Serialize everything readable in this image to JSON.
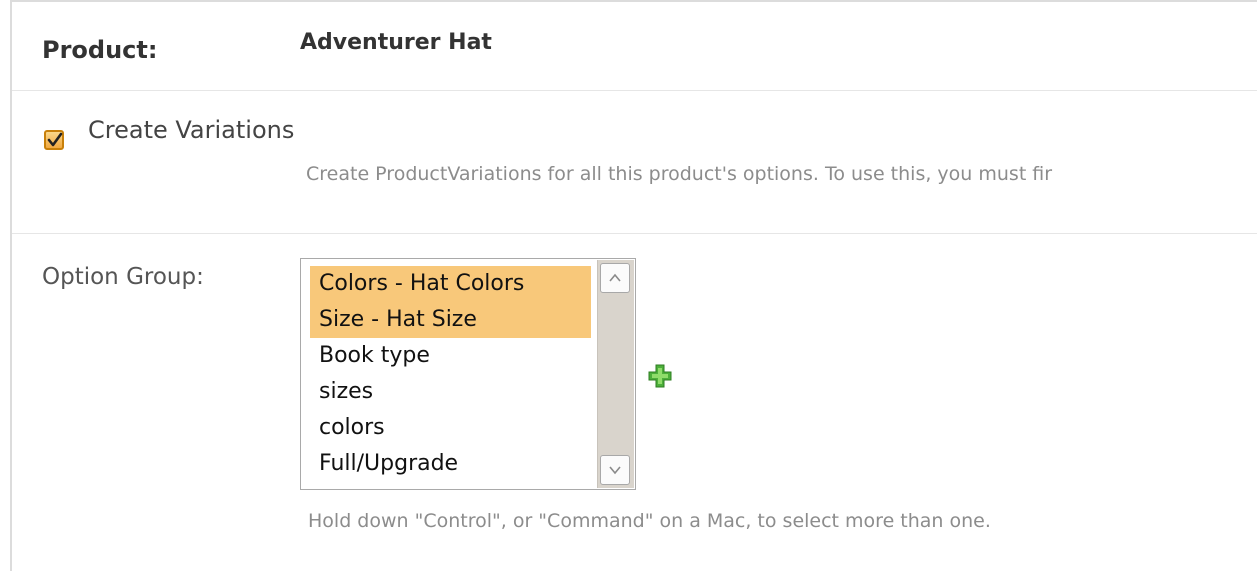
{
  "product": {
    "label": "Product:",
    "value": "Adventurer Hat"
  },
  "create_variations": {
    "label": "Create Variations",
    "checked": true,
    "help": "Create ProductVariations for all this product's options.  To use this, you must fir"
  },
  "option_group": {
    "label": "Option Group:",
    "options": [
      {
        "label": "Colors - Hat Colors",
        "selected": true
      },
      {
        "label": "Size - Hat Size",
        "selected": true
      },
      {
        "label": "Book type",
        "selected": false
      },
      {
        "label": "sizes",
        "selected": false
      },
      {
        "label": "colors",
        "selected": false
      },
      {
        "label": "Full/Upgrade",
        "selected": false
      }
    ],
    "help": "Hold down \"Control\", or \"Command\" on a Mac, to select more than one."
  },
  "icons": {
    "add": "add-plus-icon",
    "checkmark": "checkmark-icon",
    "scroll_up": "chevron-up-icon",
    "scroll_down": "chevron-down-icon"
  },
  "colors": {
    "selection": "#f8c87a",
    "checkbox": "#f1a941",
    "add_icon": "#4caf3a",
    "help_text": "#8c8c8c"
  }
}
